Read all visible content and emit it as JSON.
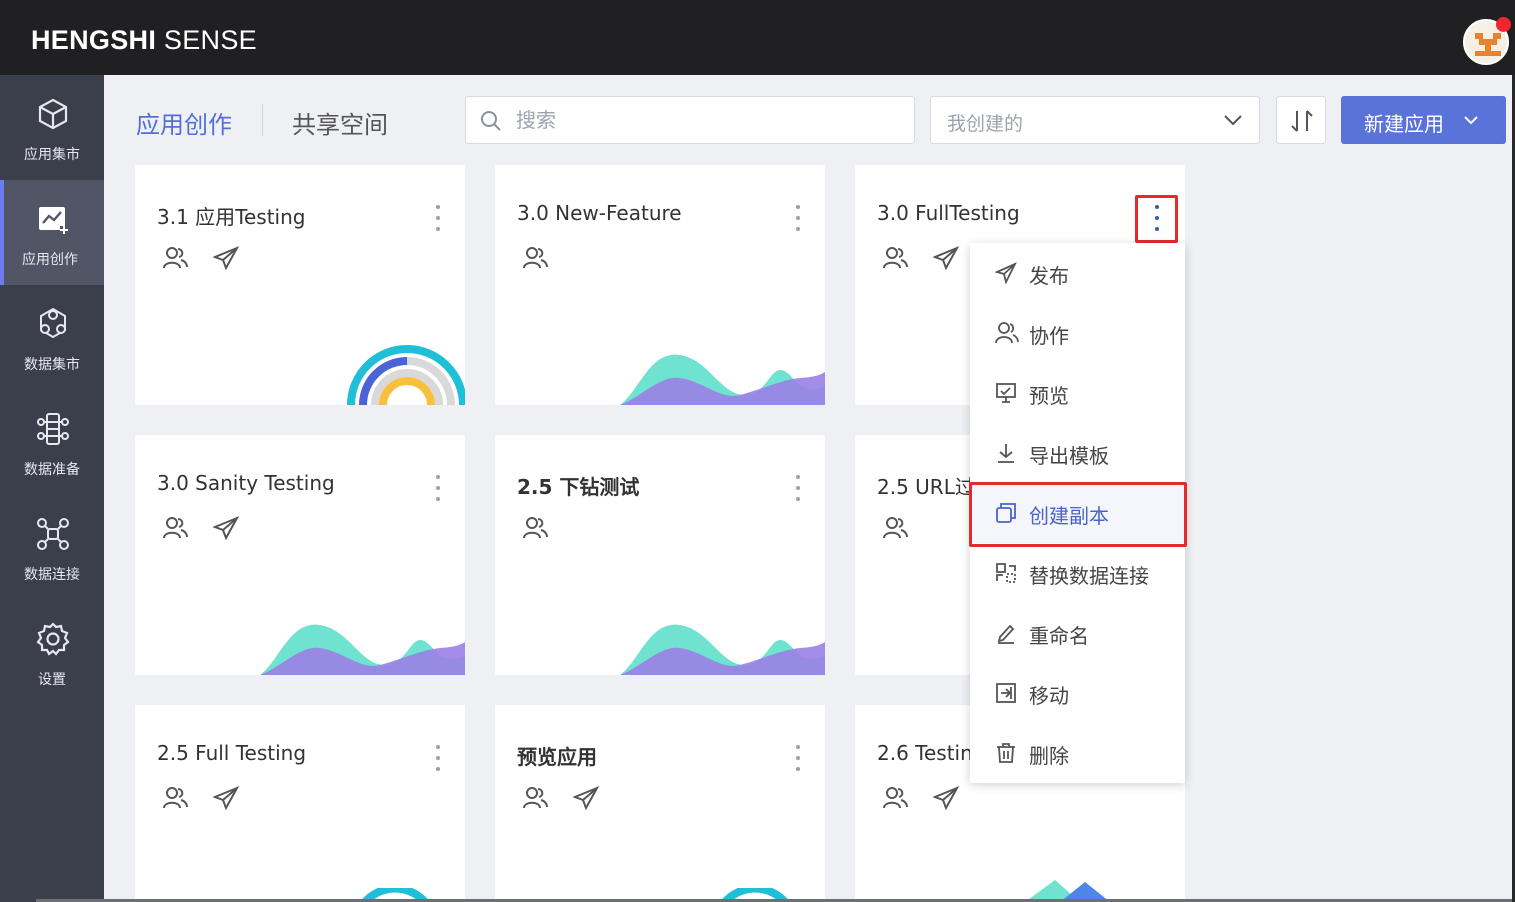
{
  "brand": {
    "bold": "HENGSHI",
    "light": " SENSE"
  },
  "sidebar": {
    "items": [
      {
        "label": "应用集市",
        "icon": "cube-icon"
      },
      {
        "label": "应用创作",
        "icon": "chart-edit-icon"
      },
      {
        "label": "数据集市",
        "icon": "dataset-icon"
      },
      {
        "label": "数据准备",
        "icon": "data-prep-icon"
      },
      {
        "label": "数据连接",
        "icon": "connection-icon"
      },
      {
        "label": "设置",
        "icon": "gear-icon"
      }
    ]
  },
  "tabs": {
    "active": "应用创作",
    "other": "共享空间"
  },
  "search": {
    "placeholder": "搜索",
    "value": ""
  },
  "filter": {
    "value": "我创建的"
  },
  "new_app": {
    "label": "新建应用"
  },
  "cards": [
    {
      "title": "3.1 应用Testing"
    },
    {
      "title": "3.0 New-Feature"
    },
    {
      "title": "3.0 FullTesting"
    },
    {
      "title": "3.0 Sanity Testing"
    },
    {
      "title": "2.5 下钻测试"
    },
    {
      "title": "2.5 URL过"
    },
    {
      "title": "2.5 Full Testing"
    },
    {
      "title": "预览应用"
    },
    {
      "title": "2.6 Testing"
    }
  ],
  "menu": {
    "items": [
      {
        "label": "发布",
        "icon": "send-icon"
      },
      {
        "label": "协作",
        "icon": "users-icon"
      },
      {
        "label": "预览",
        "icon": "preview-icon"
      },
      {
        "label": "导出模板",
        "icon": "download-icon"
      },
      {
        "label": "创建副本",
        "icon": "copy-icon"
      },
      {
        "label": "替换数据连接",
        "icon": "swap-connection-icon"
      },
      {
        "label": "重命名",
        "icon": "pencil-icon"
      },
      {
        "label": "移动",
        "icon": "move-icon"
      },
      {
        "label": "删除",
        "icon": "trash-icon"
      }
    ]
  },
  "colors": {
    "accent": "#5a73d8",
    "topbar": "#202022",
    "sidebar": "#3b3e4b",
    "highlight": "#e52a2a"
  }
}
